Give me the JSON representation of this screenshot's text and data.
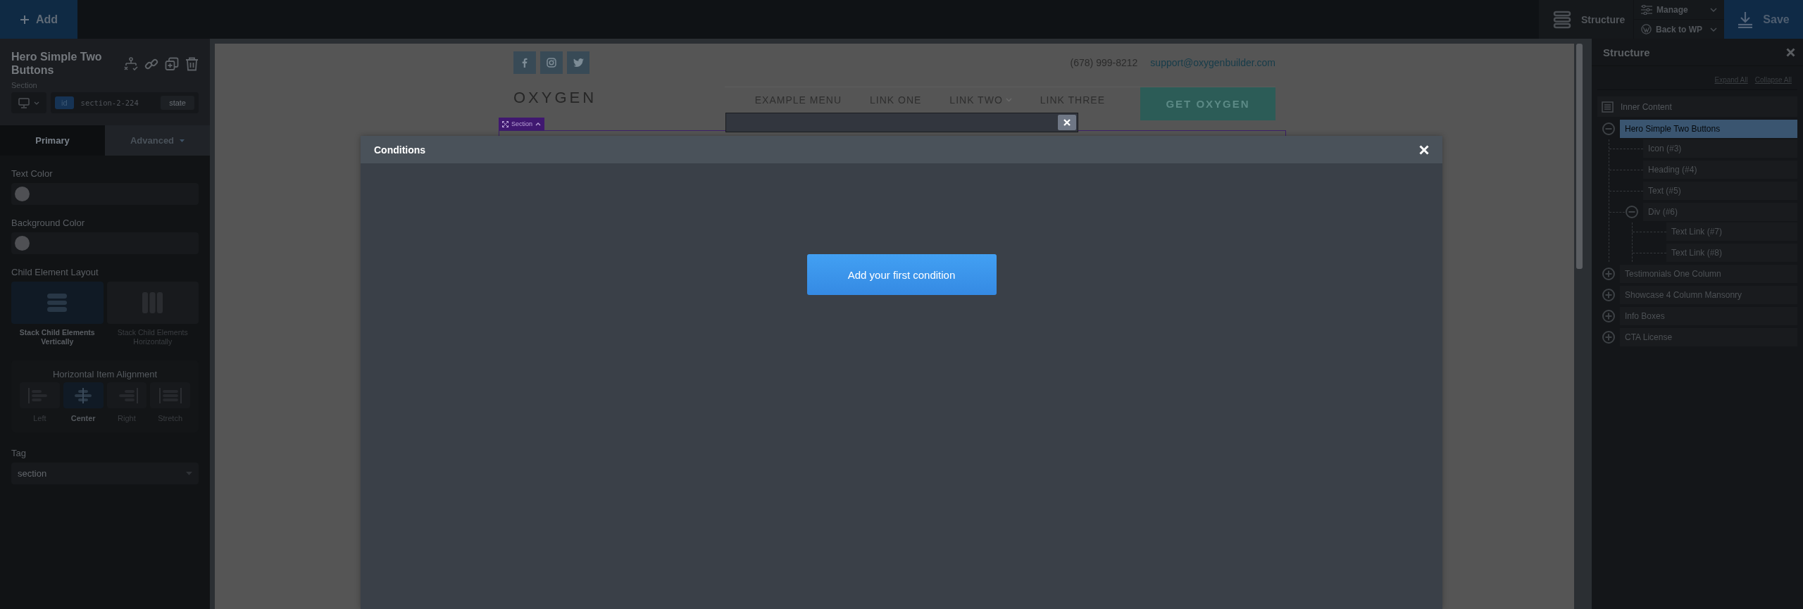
{
  "toolbar": {
    "add": "Add",
    "structure": "Structure",
    "manage": "Manage",
    "back_to_wp": "Back to WP",
    "save": "Save"
  },
  "element_panel": {
    "title": "Hero Simple Two Buttons",
    "type": "Section",
    "id_badge": "id",
    "id_value": "section-2-224",
    "state_button": "state",
    "tabs": [
      {
        "label": "Primary",
        "selected": true
      },
      {
        "label": "Advanced",
        "selected": false
      }
    ],
    "text_color_label": "Text Color",
    "background_color_label": "Background Color",
    "layout_label": "Child Element Layout",
    "layout_options": [
      {
        "label": "Stack Child Elements Vertically",
        "kind": "vertical",
        "selected": true
      },
      {
        "label": "Stack Child Elements Horizontally",
        "kind": "horizontal",
        "selected": false
      }
    ],
    "alignment_label": "Horizontal Item Alignment",
    "alignment_options": [
      {
        "label": "Left",
        "kind": "left",
        "selected": false
      },
      {
        "label": "Center",
        "kind": "center",
        "selected": true
      },
      {
        "label": "Right",
        "kind": "right",
        "selected": false
      },
      {
        "label": "Stretch",
        "kind": "stretch",
        "selected": false
      }
    ],
    "tag_label": "Tag",
    "tag_value": "section"
  },
  "site": {
    "phone": "(678) 999-8212",
    "email": "support@oxygenbuilder.com",
    "logo": "OXYGEN",
    "menu": [
      {
        "label": "EXAMPLE MENU",
        "has_submenu": false
      },
      {
        "label": "LINK ONE",
        "has_submenu": false
      },
      {
        "label": "LINK TWO",
        "has_submenu": true
      },
      {
        "label": "LINK THREE",
        "has_submenu": false
      }
    ],
    "cta": "GET OXYGEN",
    "section_tag": "Section"
  },
  "modal": {
    "title": "Conditions",
    "button": "Add your first condition"
  },
  "structure": {
    "title": "Structure",
    "expand_all": "Expand All",
    "collapse_all": "Collapse All",
    "tree": {
      "label": "Inner Content",
      "children": [
        {
          "label": "Hero Simple Two Buttons",
          "selected": true,
          "expanded": true,
          "children": [
            {
              "label": "Icon (#3)",
              "selected": false
            },
            {
              "label": "Heading (#4)",
              "selected": false
            },
            {
              "label": "Text (#5)",
              "selected": false
            },
            {
              "label": "Div (#6)",
              "selected": false,
              "expanded": true,
              "children": [
                {
                  "label": "Text Link (#7)",
                  "selected": false
                },
                {
                  "label": "Text Link (#8)",
                  "selected": false
                }
              ]
            }
          ]
        },
        {
          "label": "Testimonials One Column",
          "selected": false,
          "expanded": false
        },
        {
          "label": "Showcase 4 Column Mansonry",
          "selected": false,
          "expanded": false
        },
        {
          "label": "Info Boxes",
          "selected": false,
          "expanded": false
        },
        {
          "label": "CTA License",
          "selected": false,
          "expanded": false
        }
      ]
    }
  }
}
